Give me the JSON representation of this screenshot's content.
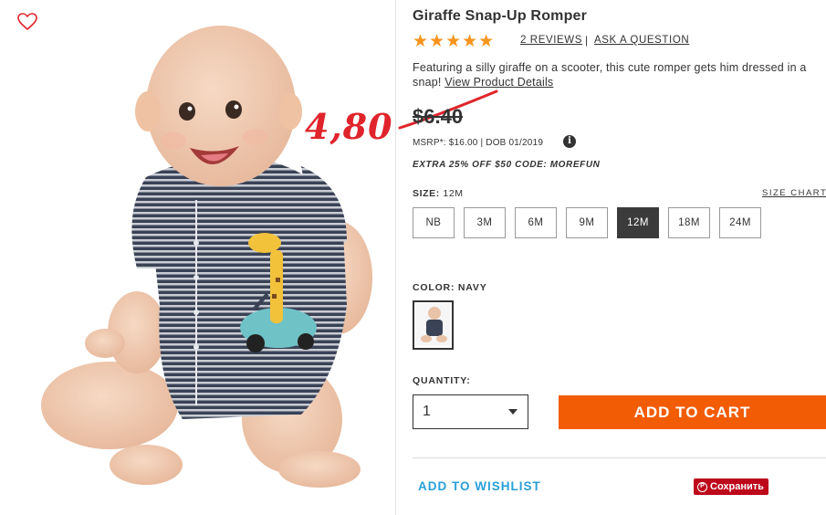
{
  "product": {
    "title": "Giraffe Snap-Up Romper",
    "stars": "★★★★★",
    "rating": 5,
    "reviews_link": "2 REVIEWS",
    "separator": "|",
    "ask_link": "ASK A QUESTION",
    "description": "Featuring a silly giraffe on a scooter, this cute romper gets him dressed in a snap!",
    "details_link": "View Product Details",
    "price": "$6.40",
    "msrp": "MSRP*: $16.00 | DOB 01/2019",
    "info_icon_glyph": "i",
    "promo": "EXTRA 25% OFF $50 CODE: MOREFUN"
  },
  "annotation": {
    "handwritten_price": "4,80",
    "color": "#e0242b"
  },
  "size": {
    "label": "SIZE:",
    "selected_value": "12M",
    "chart_link": "SIZE CHART",
    "options": [
      "NB",
      "3M",
      "6M",
      "9M",
      "12M",
      "18M",
      "24M"
    ]
  },
  "color": {
    "label": "COLOR: NAVY"
  },
  "quantity": {
    "label": "QUANTITY:",
    "value": "1"
  },
  "actions": {
    "add_to_cart": "ADD TO CART",
    "add_to_wishlist": "ADD TO WISHLIST",
    "pinterest_save": "Сохранить",
    "pinterest_icon": "P"
  },
  "colors": {
    "accent_orange": "#f25c05",
    "star_orange": "#f7941d",
    "link_blue": "#2a9fd8",
    "pinterest_red": "#bd081c",
    "heart_red": "#e0242b"
  }
}
